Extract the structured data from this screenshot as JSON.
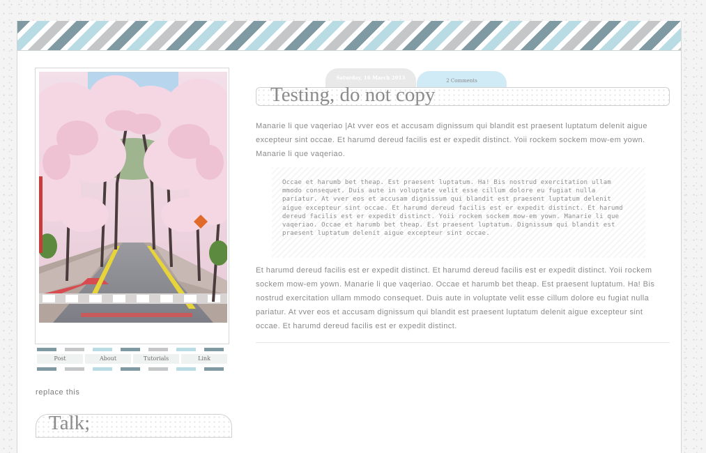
{
  "sidebar": {
    "photo_alt": "cherry blossom street",
    "nav": [
      {
        "label": "Post"
      },
      {
        "label": "About"
      },
      {
        "label": "Tutorials"
      },
      {
        "label": "Link"
      }
    ],
    "replace_text": "replace this",
    "talk_title": "Talk;"
  },
  "post": {
    "date": "Saturday, 16 March 2013",
    "comments": "2 Comments",
    "title": "Testing, do not copy",
    "para1": "Manarie li que vaqeriao |At vver eos et accusam dignissum qui blandit est praesent luptatum delenit aigue excepteur sint occae. Et harumd dereud facilis est er expedit distinct. Yoii rockem sockem mow-em yown. Manarie li que vaqeriao.",
    "quote": "Occae et harumb bet theap. Est praesent luptatum. Ha! Bis nostrud exercitation ullam mmodo consequet. Duis aute in voluptate velit esse cillum dolore eu fugiat nulla pariatur. At vver eos et accusam dignissum qui blandit est praesent luptatum delenit aigue excepteur sint occae. Et harumd dereud facilis est er expedit distinct. Et harumd dereud facilis est er expedit distinct. Yoii rockem sockem mow-em yown. Manarie li que vaqeriao. Occae et harumb bet theap. Est praesent luptatum. Dignissum qui blandit est praesent luptatum delenit aigue excepteur sint occae.",
    "para2": "Et harumd dereud facilis est er expedit distinct. Et harumd dereud facilis est er expedit distinct. Yoii rockem sockem mow-em yown. Manarie li que vaqeriao. Occae et harumb bet theap. Est praesent luptatum. Ha! Bis nostrud exercitation ullam mmodo consequet. Duis aute in voluptate velit esse cillum dolore eu fugiat nulla pariatur. At vver eos et accusam dignissum qui blandit est praesent luptatum delenit aigue excepteur sint occae. Et harumd dereud facilis est er expedit distinct."
  },
  "colors": {
    "stripe_dark": "#7f9aa2",
    "stripe_light_blue": "#b9dce4",
    "stripe_gray": "#c5c6c7",
    "tab_comments_bg": "#d0ebf6",
    "text": "#8a8a8a"
  }
}
